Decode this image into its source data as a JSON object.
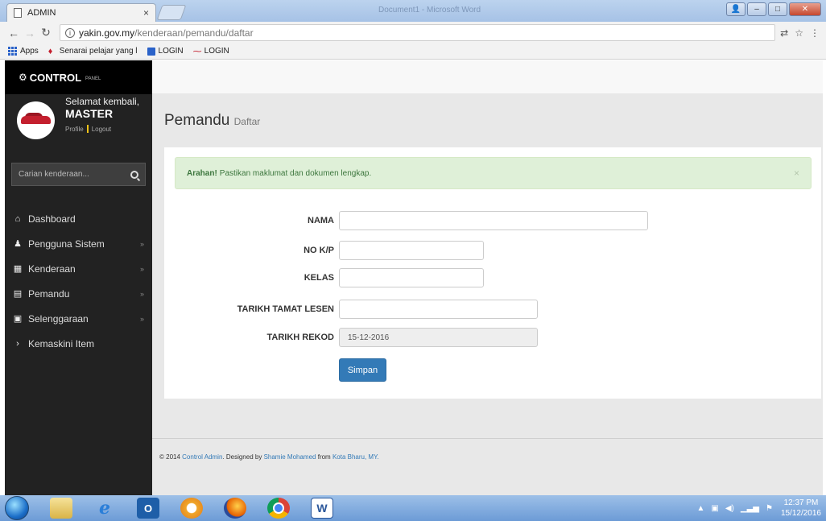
{
  "browser": {
    "tab_title": "ADMIN",
    "tab_close": "×",
    "window_title": "Document1 - Microsoft Word",
    "url_host": "yakin.gov.my",
    "url_path": "/kenderaan/pemandu/daftar",
    "bookmarks": [
      {
        "label": "Apps",
        "icon": "apps-grid-icon"
      },
      {
        "label": "Senarai pelajar yang l",
        "icon": "bookmark-red-icon"
      },
      {
        "label": "LOGIN",
        "icon": "bookmark-monitor-icon"
      },
      {
        "label": "LOGIN",
        "icon": "bookmark-dash-icon"
      }
    ]
  },
  "sidebar": {
    "brand": "CONTROL",
    "brand_sub": "PANEL",
    "welcome": "Selamat kembali,",
    "username": "MASTER",
    "profile_link": "Profile",
    "logout_link": "Logout",
    "search_placeholder": "Carian kenderaan...",
    "menu": [
      {
        "label": "Dashboard",
        "icon": "home-icon",
        "has_caret": false
      },
      {
        "label": "Pengguna Sistem",
        "icon": "user-icon",
        "has_caret": true
      },
      {
        "label": "Kenderaan",
        "icon": "grid-icon",
        "has_caret": true
      },
      {
        "label": "Pemandu",
        "icon": "list-icon",
        "has_caret": true
      },
      {
        "label": "Selenggaraan",
        "icon": "money-icon",
        "has_caret": true
      },
      {
        "label": "Kemaskini Item",
        "icon": "chevron-right-icon",
        "has_caret": false
      }
    ]
  },
  "main": {
    "title": "Pemandu",
    "subtitle": "Daftar",
    "alert_strong": "Arahan!",
    "alert_text": "Pastikan maklumat dan dokumen lengkap.",
    "form": {
      "nama_label": "NAMA",
      "nama_value": "",
      "nokp_label": "NO K/P",
      "nokp_value": "",
      "kelas_label": "KELAS",
      "kelas_value": "",
      "tarikh_tamat_label": "TARIKH TAMAT LESEN",
      "tarikh_tamat_value": "",
      "tarikh_rekod_label": "TARIKH REKOD",
      "tarikh_rekod_value": "15-12-2016",
      "submit_label": "Simpan"
    }
  },
  "footer": {
    "prefix": "© 2014",
    "link1": "Control Admin",
    "mid1": ". Designed by",
    "link2": "Shamie Mohamed",
    "mid2": "from",
    "link3": "Kota Bharu, MY."
  },
  "taskbar": {
    "time": "12:37 PM",
    "date": "15/12/2016"
  },
  "colors": {
    "sidebar_bg": "#222222",
    "alert_bg": "#dff0d8",
    "alert_text": "#3c763d",
    "primary_button": "#337ab7",
    "link": "#337ab7"
  }
}
